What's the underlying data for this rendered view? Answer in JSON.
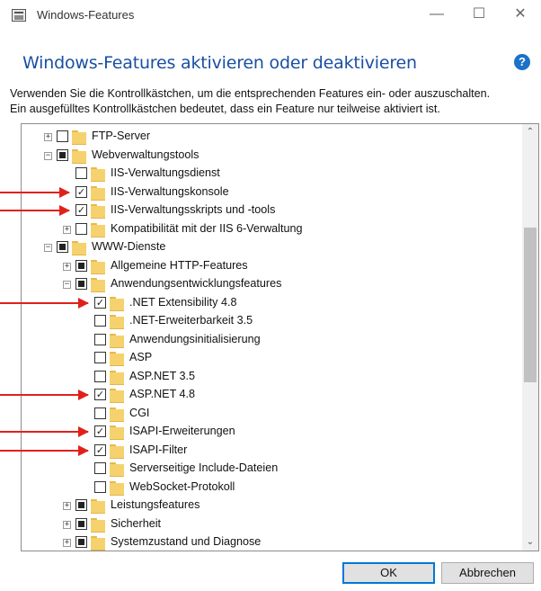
{
  "window": {
    "title": "Windows-Features",
    "minimize": "—",
    "maximize": "☐",
    "close": "✕"
  },
  "heading": "Windows-Features aktivieren oder deaktivieren",
  "help": "?",
  "description": [
    "Verwenden Sie die Kontrollkästchen, um die entsprechenden Features ein- oder auszuschalten.",
    "Ein ausgefülltes Kontrollkästchen bedeutet, dass ein Feature nur teilweise aktiviert ist."
  ],
  "tree": [
    {
      "label": "FTP-Server",
      "level": 0,
      "expander": "+",
      "state": "unchecked"
    },
    {
      "label": "Webverwaltungstools",
      "level": 0,
      "expander": "−",
      "state": "partial"
    },
    {
      "label": "IIS-Verwaltungsdienst",
      "level": 1,
      "expander": "",
      "state": "unchecked"
    },
    {
      "label": "IIS-Verwaltungskonsole",
      "level": 1,
      "expander": "",
      "state": "checked",
      "arrow": true
    },
    {
      "label": "IIS-Verwaltungsskripts und -tools",
      "level": 1,
      "expander": "",
      "state": "checked",
      "arrow": true
    },
    {
      "label": "Kompatibilität mit der IIS 6-Verwaltung",
      "level": 1,
      "expander": "+",
      "state": "unchecked"
    },
    {
      "label": "WWW-Dienste",
      "level": 0,
      "expander": "−",
      "state": "partial"
    },
    {
      "label": "Allgemeine HTTP-Features",
      "level": 1,
      "expander": "+",
      "state": "partial"
    },
    {
      "label": "Anwendungsentwicklungsfeatures",
      "level": 1,
      "expander": "−",
      "state": "partial"
    },
    {
      "label": ".NET Extensibility 4.8",
      "level": 2,
      "expander": "",
      "state": "checked",
      "arrow": true
    },
    {
      "label": ".NET-Erweiterbarkeit 3.5",
      "level": 2,
      "expander": "",
      "state": "unchecked"
    },
    {
      "label": "Anwendungsinitialisierung",
      "level": 2,
      "expander": "",
      "state": "unchecked"
    },
    {
      "label": "ASP",
      "level": 2,
      "expander": "",
      "state": "unchecked"
    },
    {
      "label": "ASP.NET 3.5",
      "level": 2,
      "expander": "",
      "state": "unchecked"
    },
    {
      "label": "ASP.NET 4.8",
      "level": 2,
      "expander": "",
      "state": "checked",
      "arrow": true
    },
    {
      "label": "CGI",
      "level": 2,
      "expander": "",
      "state": "unchecked"
    },
    {
      "label": "ISAPI-Erweiterungen",
      "level": 2,
      "expander": "",
      "state": "checked",
      "arrow": true
    },
    {
      "label": "ISAPI-Filter",
      "level": 2,
      "expander": "",
      "state": "checked",
      "arrow": true
    },
    {
      "label": "Serverseitige Include-Dateien",
      "level": 2,
      "expander": "",
      "state": "unchecked"
    },
    {
      "label": "WebSocket-Protokoll",
      "level": 2,
      "expander": "",
      "state": "unchecked"
    },
    {
      "label": "Leistungsfeatures",
      "level": 1,
      "expander": "+",
      "state": "partial"
    },
    {
      "label": "Sicherheit",
      "level": 1,
      "expander": "+",
      "state": "partial"
    },
    {
      "label": "Systemzustand und Diagnose",
      "level": 1,
      "expander": "+",
      "state": "partial"
    }
  ],
  "scroll": {
    "up": "⌃",
    "down": "⌄"
  },
  "buttons": {
    "ok": "OK",
    "cancel": "Abbrechen"
  },
  "colors": {
    "heading": "#1a4fa3",
    "arrow": "#e0211b",
    "accent": "#0078d7"
  }
}
